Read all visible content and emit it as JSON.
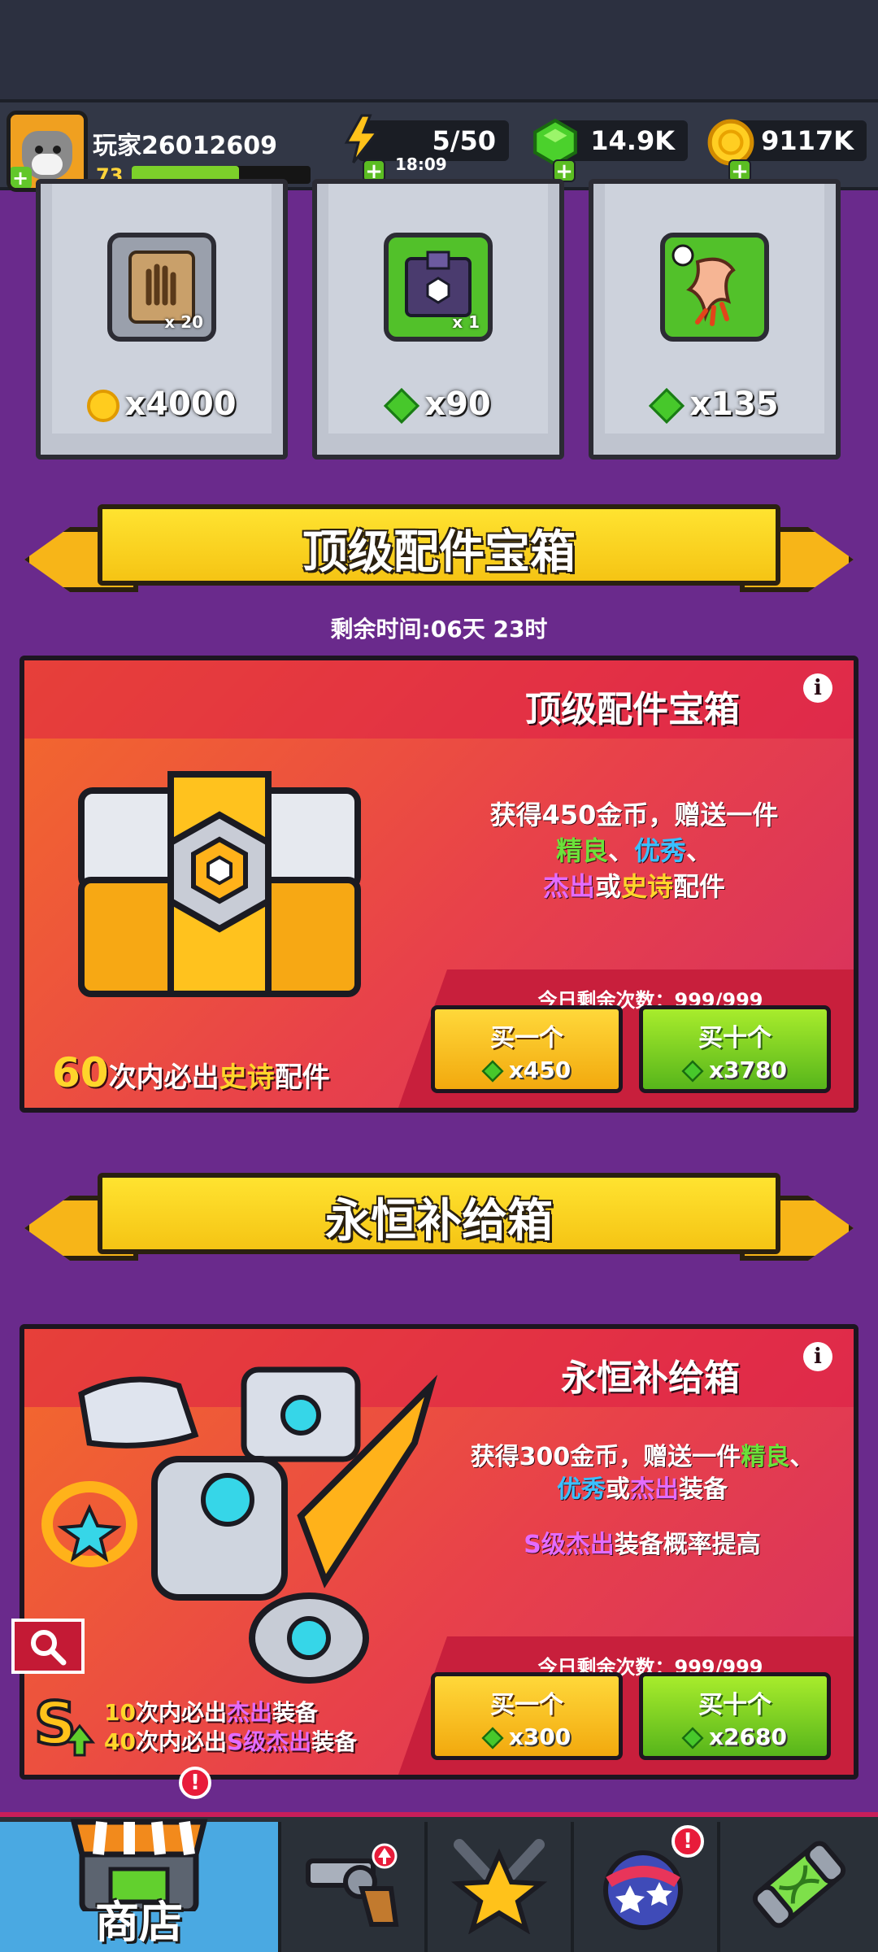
{
  "player": {
    "name": "玩家26012609",
    "level": "73",
    "xp_fraction": 0.6
  },
  "resources": {
    "energy": {
      "value": "5/50",
      "timer": "18:09"
    },
    "gems": {
      "value": "14.9K"
    },
    "coins": {
      "value": "9117K"
    }
  },
  "shop_cards": [
    {
      "item": "glove-scroll-icon",
      "qty": "x 20",
      "price": "x4000",
      "currency": "coin"
    },
    {
      "item": "crate-icon",
      "qty": "x 1",
      "price": "x90",
      "currency": "gem"
    },
    {
      "item": "claw-icon",
      "qty": "",
      "price": "x135",
      "currency": "gem"
    }
  ],
  "section1": {
    "banner_title": "顶级配件宝箱",
    "timer_text": "剩余时间:06天 23时",
    "offer_title": "顶级配件宝箱",
    "desc_line1": "获得450金币，赠送一件",
    "desc_g": "精良",
    "desc_sep1": "、",
    "desc_b": "优秀",
    "desc_sep2": "、",
    "desc_p": "杰出",
    "desc_or": "或",
    "desc_y": "史诗",
    "desc_end": "配件",
    "guarantee_num": "60",
    "guarantee_pre": "次内必出",
    "guarantee_epic": "史诗",
    "guarantee_post": "配件",
    "remaining": "今日剩余次数：999/999",
    "buy_one": {
      "label": "买一个",
      "cost": "x450"
    },
    "buy_ten": {
      "label": "买十个",
      "cost": "x3780"
    }
  },
  "section2": {
    "banner_title": "永恒补给箱",
    "offer_title": "永恒补给箱",
    "desc_line1_pre": "获得300金币，赠送一件",
    "desc_g": "精良",
    "desc_sep": "、",
    "desc_b": "优秀",
    "desc_or": "或",
    "desc_p": "杰出",
    "desc_end": "装备",
    "boost_s": "S级杰出",
    "boost_rest": "装备概率提高",
    "g1_num": "10",
    "g1_pre": "次内必出",
    "g1_p": "杰出",
    "g1_post": "装备",
    "g2_num": "40",
    "g2_pre": "次内必出",
    "g2_p": "S级杰出",
    "g2_post": "装备",
    "remaining": "今日剩余次数：999/999",
    "buy_one": {
      "label": "买一个",
      "cost": "x300"
    },
    "buy_ten": {
      "label": "买十个",
      "cost": "x2680"
    }
  },
  "nav": {
    "shop_label": "商店",
    "shop_alert": "!",
    "ball_alert": "!"
  },
  "colors": {
    "rarity_good": "#6be23a",
    "rarity_excellent": "#39c0ff",
    "rarity_outstanding": "#e36cff",
    "rarity_epic": "#ffd52b"
  }
}
